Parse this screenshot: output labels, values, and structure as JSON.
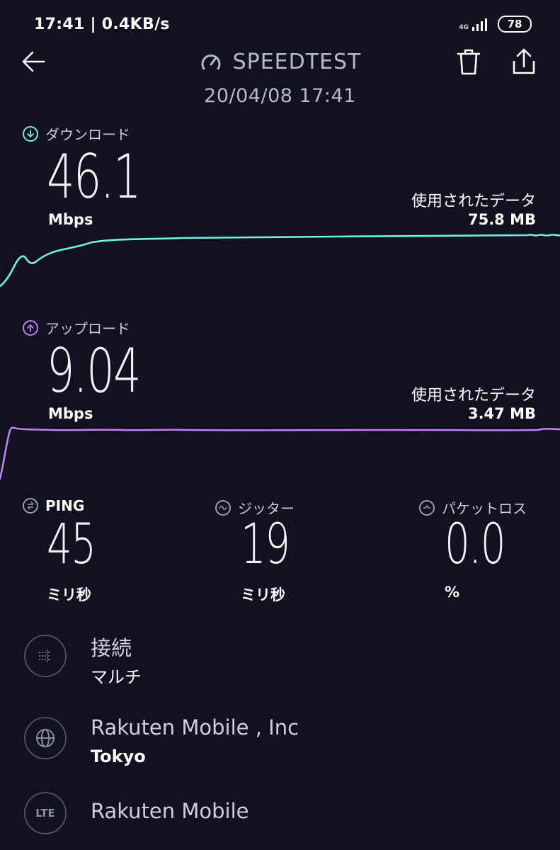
{
  "status_bar": {
    "time_speed": "17:41 | 0.4KB/s",
    "network": "4G",
    "battery": "78"
  },
  "header": {
    "title": "SPEEDTEST",
    "datetime": "20/04/08 17:41"
  },
  "download": {
    "label": "ダウンロード",
    "value": "46.1",
    "unit": "Mbps",
    "data_used_label": "使用されたデータ",
    "data_used_value": "75.8 MB",
    "color": "#6ff0e0"
  },
  "upload": {
    "label": "アップロード",
    "value": "9.04",
    "unit": "Mbps",
    "data_used_label": "使用されたデータ",
    "data_used_value": "3.47 MB",
    "color": "#c17ef5"
  },
  "stats": {
    "ping": {
      "label": "PING",
      "value": "45",
      "unit": "ミリ秒"
    },
    "jitter": {
      "label": "ジッター",
      "value": "19",
      "unit": "ミリ秒"
    },
    "packet_loss": {
      "label": "パケットロス",
      "value": "0.0",
      "unit": "%"
    }
  },
  "connection": {
    "title": "接続",
    "subtitle": "マルチ"
  },
  "server": {
    "title": "Rakuten Mobile , Inc",
    "subtitle": "Tokyo"
  },
  "provider": {
    "icon_text": "LTE",
    "title": "Rakuten Mobile"
  },
  "chart_data": [
    {
      "type": "line",
      "series": [
        {
          "name": "",
          "values": [
            2,
            20,
            30,
            38,
            40,
            42,
            43,
            44,
            44.5,
            45,
            45.2,
            45.5,
            45.6,
            45.8,
            45.9,
            46,
            46,
            46.1,
            46.1,
            46.1
          ]
        }
      ]
    },
    {
      "type": "line",
      "series": [
        {
          "name": "",
          "values": [
            0,
            9.0,
            9.04,
            9.02,
            9.04,
            9.03,
            9.05,
            9.04,
            9.04,
            9.03,
            9.04,
            9.04,
            9.05,
            9.04,
            9.04,
            9.04,
            9.03,
            9.04,
            9.04,
            9.04
          ]
        }
      ]
    }
  ]
}
